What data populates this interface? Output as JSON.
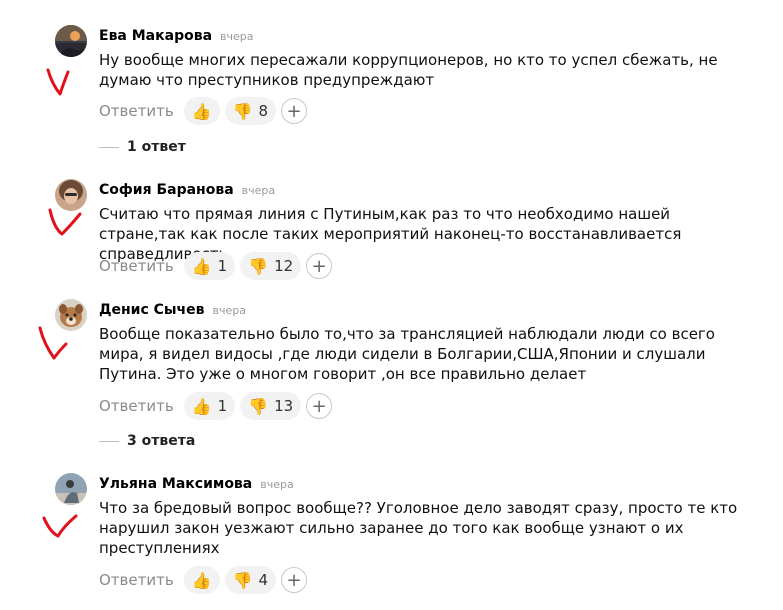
{
  "reply_label": "Ответить",
  "comments": [
    {
      "author": "Ева Макарова",
      "time": "вчера",
      "text": "Ну вообще многих пересажали коррупционеров, но кто то успел сбежать, не думаю что преступников предупреждают",
      "likes": "",
      "dislikes": "8",
      "thread": "1 ответ",
      "avatar_icon": "sunset-photo"
    },
    {
      "author": "София Баранова",
      "time": "вчера",
      "text": "Считаю что прямая линия с Путиным,как раз то что необходимо нашей стране,так как после таких мероприятий наконец-то восстанавливается справедливость",
      "likes": "1",
      "dislikes": "12",
      "thread": "",
      "avatar_icon": "woman-photo"
    },
    {
      "author": "Денис Сычев",
      "time": "вчера",
      "text": "Вообще показательно было то,что за трансляцией наблюдали люди со всего мира, я видел видосы ,где люди сидели в Болгарии,США,Японии и слушали Путина. Это уже о многом говорит ,он все правильно делает",
      "likes": "1",
      "dislikes": "13",
      "thread": "3 ответа",
      "avatar_icon": "dog-photo"
    },
    {
      "author": "Ульяна Максимова",
      "time": "вчера",
      "text": "Что за бредовый вопрос вообще?? Уголовное дело заводят сразу, просто те кто нарушил закон уезжают сильно заранее до того как вообще узнают о их преступлениях",
      "likes": "",
      "dislikes": "4",
      "thread": "",
      "avatar_icon": "person-photo"
    }
  ],
  "annotation_color": "#e0111a"
}
